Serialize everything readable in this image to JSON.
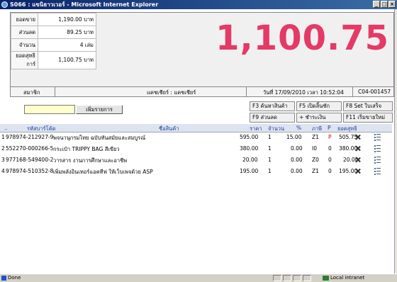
{
  "window": {
    "title": "S066 : แขนิธาวเวอร์ - Microsoft Internet Explorer",
    "btn_min": "_",
    "btn_max": "□",
    "btn_close": "×"
  },
  "summary": {
    "rows": [
      {
        "label": "ยอดขาย",
        "value": "1,190.00 บาท"
      },
      {
        "label": "ส่วนลด",
        "value": "89.25 บาท"
      },
      {
        "label": "จำนวน",
        "value": "4 เล่ม"
      },
      {
        "label": "ยอดสุทธิการ์",
        "value": "1,100.75 บาท"
      }
    ],
    "total": "1,100.75"
  },
  "info": {
    "member_label": "สมาชิก",
    "cashier": "แคชเชียร์ : แคชเชียร์",
    "datetime": "วันที่ 17/09/2010 เวลา 10:52:04",
    "receipt_no": "C04-001457"
  },
  "entry": {
    "input_value": "",
    "add_button": "เพิ่มรายการ"
  },
  "fkeys": {
    "f3": "F3 ค้นหาสินค้า",
    "f5": "F5 เปิดลิ้นชัก",
    "f8": "F8 Set ใบเสร็จ",
    "f9": "F9 ส่วนลด",
    "pay": "+ ชำระเงิน",
    "f11": "F11 เริ่มขายใหม่"
  },
  "grid": {
    "headers": {
      "barcode": "รหัสบาร์โค้ด",
      "name": "ชื่อสินค้า",
      "price": "ราคา",
      "qty": "จำนวน",
      "pct": "%",
      "tax": "ภาษี",
      "p": "P",
      "net": "ยอดสุทธิ"
    },
    "rows": [
      {
        "no": "1",
        "barcode": "978974-212927-9",
        "name": "พจนานุกรมไทย ฉบับทันสมัยและสมบูรณ์",
        "price": "595.00",
        "qty": "1",
        "pct": "15.00",
        "tax": "Z1",
        "p": "P",
        "net": "505.75"
      },
      {
        "no": "2",
        "barcode": "552270-000266-5",
        "name": "กระเป๋า TRIPPY BAG สีเขียว",
        "price": "380.00",
        "qty": "1",
        "pct": "0.00",
        "tax": "I0",
        "p": "0",
        "net": "380.00"
      },
      {
        "no": "3",
        "barcode": "977168-549400-2",
        "name": "วารสาร งานการศึกษาและอาชีพ",
        "price": "20.00",
        "qty": "1",
        "pct": "0.00",
        "tax": "Z0",
        "p": "0",
        "net": "20.00"
      },
      {
        "no": "4",
        "barcode": "978974-510352-8",
        "name": "เพิ่มพลังอินเทอร์แอคทีฟ ให้เว็บเพจด้วย ASP",
        "price": "195.00",
        "qty": "1",
        "pct": "0.00",
        "tax": "Z1",
        "p": "0",
        "net": "195.00"
      }
    ]
  },
  "status": {
    "left": "Done",
    "zone": "Local intranet"
  },
  "colors": {
    "total": "#e43a66",
    "header_text": "#1a3e9a",
    "p_flag": "#cc0000"
  }
}
